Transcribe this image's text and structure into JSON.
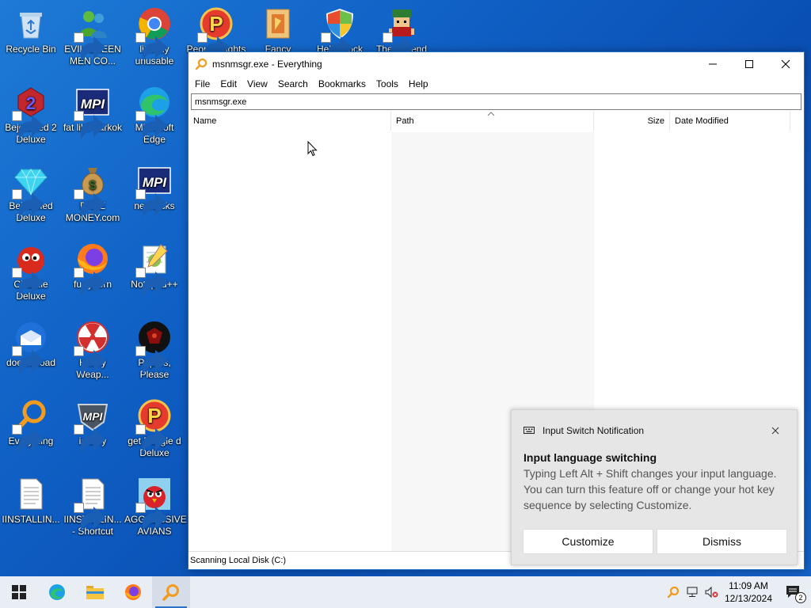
{
  "desktop": {
    "icons": [
      {
        "label": "Recycle Bin",
        "icon": "recycle-bin-icon"
      },
      {
        "label": "EVIL GREEN MEN CO...",
        "icon": "msn-people-icon"
      },
      {
        "label": "literally unusable",
        "icon": "chrome-icon"
      },
      {
        "label": "People Nights",
        "icon": "peggle-icon"
      },
      {
        "label": "Fancy",
        "icon": "folder-icon"
      },
      {
        "label": "Hello Dock",
        "icon": "shield-icon"
      },
      {
        "label": "The Legend",
        "icon": "pixel-character-icon"
      },
      {
        "label": "Bejeweled 2 Deluxe",
        "icon": "bejeweled2-icon"
      },
      {
        "label": "fat like darkok",
        "icon": "mpi-icon"
      },
      {
        "label": "Microsoft Edge",
        "icon": "edge-icon"
      },
      {
        "label": "Bejeweled Deluxe",
        "icon": "diamond-icon"
      },
      {
        "label": "FREE MONEY.com",
        "icon": "money-bag-icon"
      },
      {
        "label": "nephacks",
        "icon": "mpi-icon"
      },
      {
        "label": "Chuzzle Deluxe",
        "icon": "chuzzle-icon"
      },
      {
        "label": "furryporn",
        "icon": "firefox-icon"
      },
      {
        "label": "Notepad++",
        "icon": "notepadpp-icon"
      },
      {
        "label": "doesnt load",
        "icon": "thunderbird-icon"
      },
      {
        "label": "Heavy Weap...",
        "icon": "radiation-icon"
      },
      {
        "label": "Papers, Please",
        "icon": "papers-please-icon"
      },
      {
        "label": "Everything",
        "icon": "everything-icon"
      },
      {
        "label": "is very",
        "icon": "mpi-shield-icon"
      },
      {
        "label": "get Peggle d Deluxe",
        "icon": "peggle-icon"
      },
      {
        "label": "IINSTALLIN...",
        "icon": "text-file-icon"
      },
      {
        "label": "IINSTALLIN... - Shortcut",
        "icon": "text-file-icon"
      },
      {
        "label": "AGGRESSIVE AVIANS",
        "icon": "angry-bird-icon"
      }
    ]
  },
  "window": {
    "title": "msnmsgr.exe - Everything",
    "menu": [
      "File",
      "Edit",
      "View",
      "Search",
      "Bookmarks",
      "Tools",
      "Help"
    ],
    "search_value": "msnmsgr.exe",
    "columns": {
      "name": "Name",
      "path": "Path",
      "size": "Size",
      "date": "Date Modified"
    },
    "status": "Scanning Local Disk (C:)"
  },
  "notification": {
    "header": "Input Switch Notification",
    "title": "Input language switching",
    "body": "Typing Left Alt + Shift changes your input language. You can turn this feature off or change your hot key sequence by selecting Customize.",
    "customize_label": "Customize",
    "dismiss_label": "Dismiss"
  },
  "taskbar": {
    "time": "11:09 AM",
    "date": "12/13/2024",
    "notification_count": "2"
  },
  "colors": {
    "accent": "#2a73c9",
    "desktop_bg": "#0f5fc4",
    "everything_orange": "#f29b1f"
  }
}
